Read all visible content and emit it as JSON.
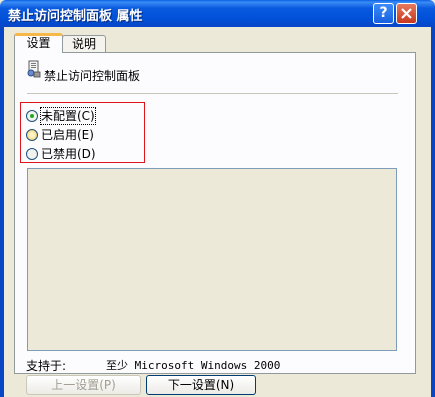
{
  "window": {
    "title": "禁止访问控制面板 属性",
    "help_label": "?"
  },
  "tabs": [
    {
      "label": "设置",
      "active": true
    },
    {
      "label": "说明",
      "active": false
    }
  ],
  "policy": {
    "name": "禁止访问控制面板"
  },
  "options": [
    {
      "label": "未配置(C)",
      "selected": true
    },
    {
      "label": "已启用(E)",
      "selected": false
    },
    {
      "label": "已禁用(D)",
      "selected": false
    }
  ],
  "supported": {
    "label": "支持于:",
    "value": "至少 Microsoft Windows 2000"
  },
  "buttons": {
    "prev": "上一设置(P)",
    "next": "下一设置(N)"
  },
  "colors": {
    "titlebar": "#0A5AE0",
    "highlight_border": "#E0151B",
    "dialog_bg": "#ECE9D8"
  }
}
